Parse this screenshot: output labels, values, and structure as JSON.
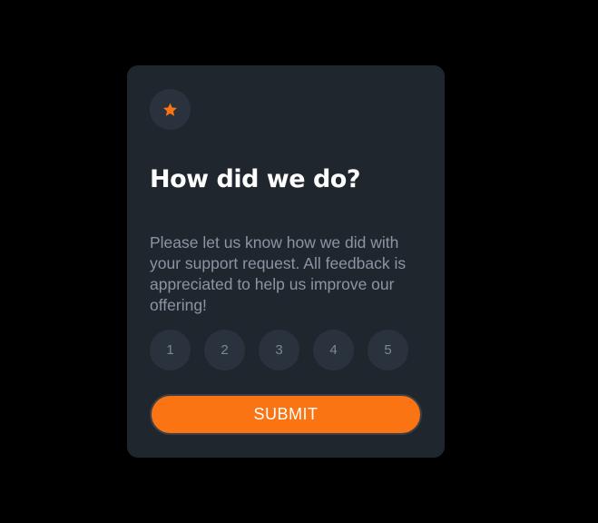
{
  "card": {
    "title": "How did we do?",
    "description": "Please let us know how we did with your support request. All feedback is appreciated to help us improve our offering!",
    "icon": "star-icon",
    "ratings": [
      "1",
      "2",
      "3",
      "4",
      "5"
    ],
    "submit_label": "SUBMIT"
  },
  "colors": {
    "page_background": "#000000",
    "card_background": "#1f262e",
    "accent": "#fb7413",
    "circle_background": "#2a323d",
    "muted_text": "#8c95a3"
  }
}
